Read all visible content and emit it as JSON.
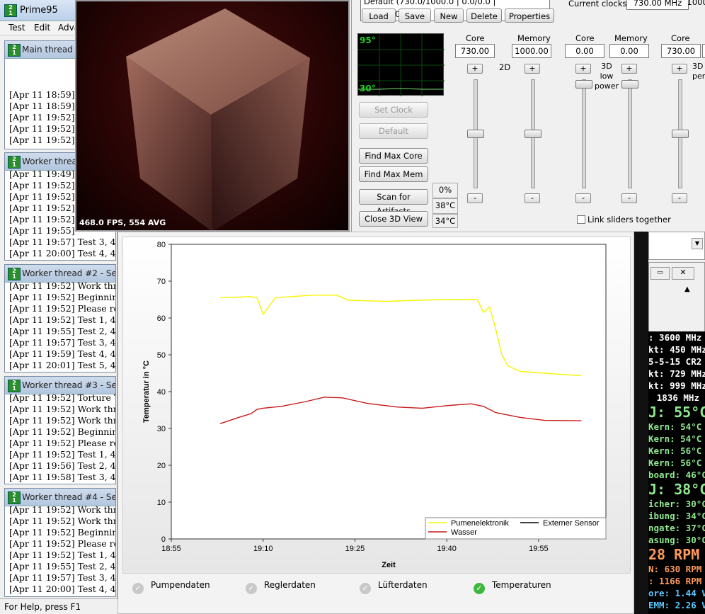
{
  "prime95": {
    "title": "Prime95",
    "menu": [
      "Test",
      "Edit",
      "Adva"
    ],
    "status": "For Help, press F1",
    "windows": [
      {
        "title": "Main thread",
        "lines": [
          "[Apr 11 18:59]",
          "[Apr 11 18:59]",
          "[Apr 11 19:52]",
          "[Apr 11 19:52]",
          "[Apr 11 19:52]"
        ]
      },
      {
        "title": "Worker thread",
        "lines": [
          "[Apr 11 19:49]",
          "[Apr 11 19:52]",
          "[Apr 11 19:52]",
          "[Apr 11 19:52]",
          "[Apr 11 19:52]",
          "[Apr 11 19:55]",
          "[Apr 11 19:57] Test 3, 4",
          "[Apr 11 20:00] Test 4, 4"
        ]
      },
      {
        "title": "Worker thread #2 - Self-T",
        "lines": [
          "[Apr 11 19:52] Work thr",
          "[Apr 11 19:52] Beginnin",
          "[Apr 11 19:52] Please re",
          "[Apr 11 19:52] Test 1, 4",
          "[Apr 11 19:55] Test 2, 4",
          "[Apr 11 19:57] Test 3, 4",
          "[Apr 11 19:59] Test 4, 4",
          "[Apr 11 20:01] Test 5, 4"
        ]
      },
      {
        "title": "Worker thread #3 - Self-T",
        "lines": [
          "[Apr 11 19:52] Torture T",
          "[Apr 11 19:52] Work thr",
          "[Apr 11 19:52] Work thr",
          "[Apr 11 19:52] Beginnin",
          "[Apr 11 19:52] Please re",
          "[Apr 11 19:52] Test 1, 4",
          "[Apr 11 19:56] Test 2, 4",
          "[Apr 11 19:58] Test 3, 4"
        ]
      },
      {
        "title": "Worker thread #4 - Self-T",
        "lines": [
          "[Apr 11 19:52] Work thr",
          "[Apr 11 19:52] Work thr",
          "[Apr 11 19:52] Beginnin",
          "[Apr 11 19:52] Please re",
          "[Apr 11 19:52] Test 1, 4",
          "[Apr 11 19:55] Test 2, 4",
          "[Apr 11 19:57] Test 3, 4",
          "[Apr 11 20:00] Test 4, 4"
        ]
      }
    ]
  },
  "view3d": {
    "fps": "468.0 FPS, 554 AVG"
  },
  "gpu": {
    "profile": "Default (730.0/1000.0 | 0.0/0.0 | 730.0/1000.0)",
    "clock_label": "Current clocks:",
    "clock_value": "730.00 MHz",
    "clock_value2": "1000.",
    "buttons": {
      "load": "Load",
      "save": "Save",
      "new": "New",
      "delete": "Delete",
      "properties": "Properties"
    },
    "monitor": {
      "top": "95°",
      "bottom": "30°"
    },
    "left_buttons": {
      "set_clock": "Set Clock",
      "default": "Default",
      "find_max_core": "Find Max Core",
      "find_max_mem": "Find Max Mem",
      "scan": "Scan for Artifacts",
      "close": "Close 3D View"
    },
    "readouts": {
      "percent": "0%",
      "temp1": "38°C",
      "temp2": "34°C"
    },
    "groups": [
      {
        "core_label": "Core",
        "mem_label": "Memory",
        "core": "730.00",
        "mem": "1000.00",
        "name": "2D"
      },
      {
        "core_label": "Core",
        "mem_label": "Memory",
        "core": "0.00",
        "mem": "0.00",
        "name": "3D low power"
      },
      {
        "core_label": "Core",
        "core": "730.00",
        "name": "3D perf"
      }
    ],
    "plus": "+",
    "minus": "-",
    "link_label": "Link sliders together"
  },
  "chart_data": {
    "type": "line",
    "title": "",
    "xlabel": "Zeit",
    "ylabel": "Temperatur in °C",
    "xlim": [
      "18:55",
      "20:06"
    ],
    "ylim": [
      0,
      80
    ],
    "x_ticks": [
      "18:55",
      "19:10",
      "19:25",
      "19:40",
      "19:55"
    ],
    "y_ticks": [
      0,
      10,
      20,
      30,
      40,
      50,
      60,
      70,
      80
    ],
    "grid": "vertical-dotted",
    "legend": "bottom-right",
    "series": [
      {
        "name": "Pumenelektronik",
        "color": "#f5f500",
        "x": [
          "19:03",
          "19:08",
          "19:09",
          "19:10",
          "19:12",
          "19:18",
          "19:22",
          "19:24",
          "19:30",
          "19:35",
          "19:40",
          "19:45",
          "19:46",
          "19:47",
          "19:48",
          "19:49",
          "19:50",
          "19:52",
          "19:56",
          "20:02"
        ],
        "y": [
          65.5,
          65.8,
          65.5,
          61,
          65.5,
          66.2,
          66.2,
          64.8,
          64.5,
          64.8,
          65,
          65,
          61.5,
          63,
          57,
          50,
          47,
          45.5,
          45,
          44.3
        ]
      },
      {
        "name": "Externer Sensor",
        "color": "#000000",
        "x": [],
        "y": []
      },
      {
        "name": "Wasser",
        "color": "#c81a1a",
        "x": [
          "19:03",
          "19:06",
          "19:08",
          "19:09",
          "19:10",
          "19:13",
          "19:17",
          "19:20",
          "19:23",
          "19:27",
          "19:32",
          "19:36",
          "19:40",
          "19:44",
          "19:46",
          "19:48",
          "19:52",
          "19:56",
          "20:02"
        ],
        "y": [
          31.3,
          33,
          34,
          35.2,
          35.5,
          36,
          37.3,
          38.5,
          38.3,
          36.8,
          35.8,
          35.5,
          36.2,
          36.7,
          36,
          34.3,
          33,
          32.2,
          32.1
        ]
      }
    ]
  },
  "tabs": [
    {
      "label": "Pumpendaten",
      "active": false
    },
    {
      "label": "Reglerdaten",
      "active": false
    },
    {
      "label": "Lüfterdaten",
      "active": false
    },
    {
      "label": "Temperaturen",
      "active": true
    }
  ],
  "rmon": {
    "lines": [
      {
        "text": ": 3600 MHz",
        "color": "#ffffff"
      },
      {
        "text": "kt: 450 MHz",
        "color": "#ffffff"
      },
      {
        "text": "5-5-15 CR2",
        "color": "#ffffff"
      },
      {
        "text": "kt: 729 MHz",
        "color": "#ffffff"
      },
      {
        "text": "kt: 999 MHz",
        "color": "#ffffff"
      },
      {
        "text": "1836 MHz",
        "color": "#ffffff"
      },
      {
        "text": "J: 55°C",
        "color": "#8ee88e",
        "big": true
      },
      {
        "text": "Kern: 54°C",
        "color": "#8ee88e"
      },
      {
        "text": "Kern: 54°C",
        "color": "#8ee88e"
      },
      {
        "text": "Kern: 56°C",
        "color": "#8ee88e"
      },
      {
        "text": "Kern: 56°C",
        "color": "#8ee88e"
      },
      {
        "text": "board: 46°C",
        "color": "#8ee88e"
      },
      {
        "text": "J: 38°C",
        "color": "#8ee88e",
        "big": true
      },
      {
        "text": "icher: 30°C",
        "color": "#8ee88e"
      },
      {
        "text": "ibung: 34°C",
        "color": "#8ee88e"
      },
      {
        "text": "ngate: 37°C",
        "color": "#8ee88e"
      },
      {
        "text": "asung: 30°C",
        "color": "#8ee88e"
      },
      {
        "text": "28 RPM",
        "color": "#ff9a5a",
        "big": true
      },
      {
        "text": "N: 630 RPM",
        "color": "#ff9a5a"
      },
      {
        "text": ": 1166 RPM",
        "color": "#ff9a5a"
      },
      {
        "text": "ore: 1.44 V",
        "color": "#5ac8ff"
      },
      {
        "text": "EMM: 2.26 V",
        "color": "#5ac8ff"
      },
      {
        "text": "M",
        "color": "#ffffff"
      }
    ]
  }
}
